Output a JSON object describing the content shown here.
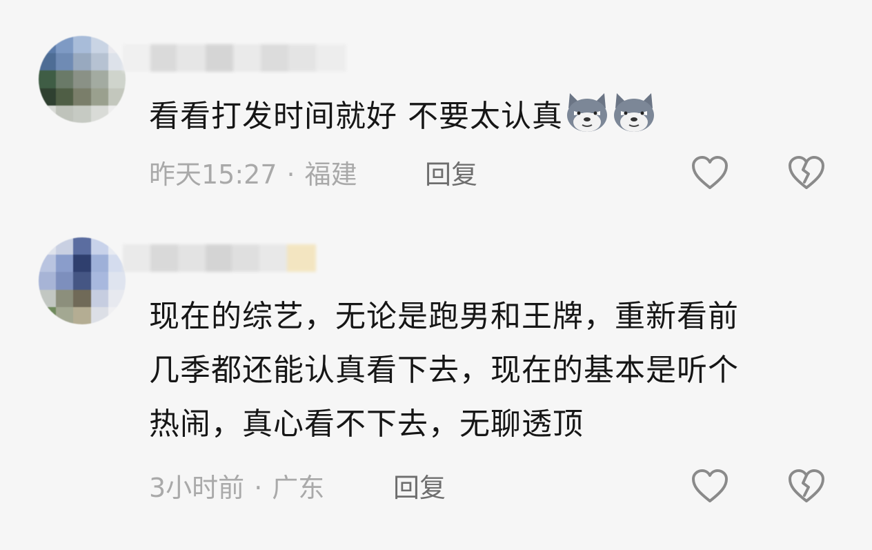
{
  "comments": [
    {
      "body_lines": [
        "看看打发时间就好 不要太认真"
      ],
      "emojis": [
        "wolf-emoji",
        "wolf-emoji"
      ],
      "time": "昨天15:27",
      "separator": "·",
      "location": "福建",
      "reply_label": "回复",
      "like_icon": "heart-outline-icon",
      "dislike_icon": "broken-heart-icon"
    },
    {
      "body_lines": [
        "现在的综艺，无论是跑男和王牌，重新看前",
        "几季都还能认真看下去，现在的基本是听个",
        "热闹，真心看不下去，无聊透顶"
      ],
      "time": "3小时前",
      "separator": "·",
      "location": "广东",
      "reply_label": "回复",
      "like_icon": "heart-outline-icon",
      "dislike_icon": "broken-heart-icon"
    }
  ],
  "colors": {
    "background": "#f6f6f6",
    "text": "#161616",
    "meta": "#a9a9a9",
    "reply": "#6e6e6e",
    "icon": "#8a8a8a"
  }
}
